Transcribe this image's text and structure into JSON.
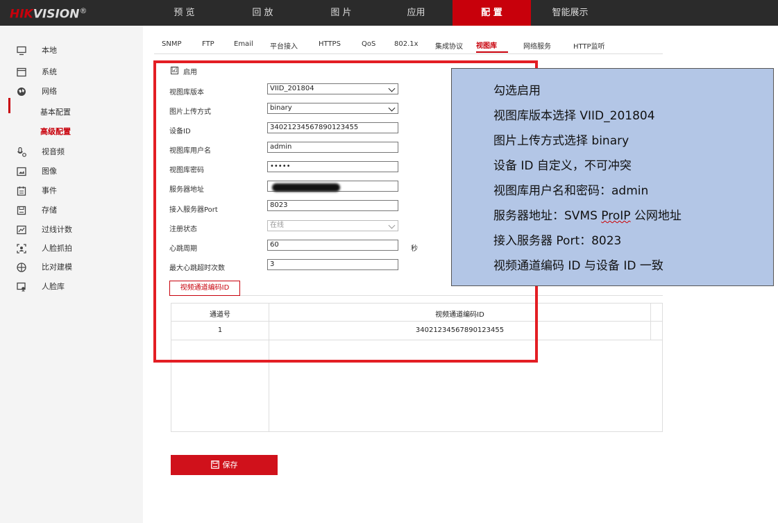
{
  "brand": {
    "name_red": "HIK",
    "name_white": "VISION",
    "mark": "®"
  },
  "top_nav": [
    {
      "label": "预 览",
      "active": false
    },
    {
      "label": "回 放",
      "active": false
    },
    {
      "label": "图 片",
      "active": false
    },
    {
      "label": "应用",
      "active": false
    },
    {
      "label": "配 置",
      "active": true
    },
    {
      "label": "智能展示",
      "active": false
    }
  ],
  "sidebar": {
    "items": [
      {
        "label": "本地",
        "icon": "monitor-icon"
      },
      {
        "label": "系统",
        "icon": "system-icon"
      },
      {
        "label": "网络",
        "icon": "globe-icon"
      },
      {
        "label": "视音频",
        "icon": "audio-video-icon"
      },
      {
        "label": "图像",
        "icon": "image-icon"
      },
      {
        "label": "事件",
        "icon": "calendar-icon"
      },
      {
        "label": "存储",
        "icon": "save-icon"
      },
      {
        "label": "过线计数",
        "icon": "line-count-icon"
      },
      {
        "label": "人脸抓拍",
        "icon": "face-capture-icon"
      },
      {
        "label": "比对建模",
        "icon": "compare-model-icon"
      },
      {
        "label": "人脸库",
        "icon": "face-library-icon"
      }
    ],
    "network_sub": [
      {
        "label": "基本配置",
        "active": false
      },
      {
        "label": "高级配置",
        "active": true
      }
    ]
  },
  "sub_tabs": [
    {
      "label": "SNMP",
      "active": false
    },
    {
      "label": "FTP",
      "active": false
    },
    {
      "label": "Email",
      "active": false
    },
    {
      "label": "平台接入",
      "active": false
    },
    {
      "label": "HTTPS",
      "active": false
    },
    {
      "label": "QoS",
      "active": false
    },
    {
      "label": "802.1x",
      "active": false
    },
    {
      "label": "集成协议",
      "active": false
    },
    {
      "label": "视图库",
      "active": true
    },
    {
      "label": "网络服务",
      "active": false
    },
    {
      "label": "HTTP监听",
      "active": false
    }
  ],
  "form": {
    "enable_label": "启用",
    "enable_checked": "☑",
    "fields": [
      {
        "label": "视图库版本",
        "value": "VIID_201804"
      },
      {
        "label": "图片上传方式",
        "value": "binary"
      },
      {
        "label": "设备ID",
        "value": "34021234567890123455"
      },
      {
        "label": "视图库用户名",
        "value": "admin"
      },
      {
        "label": "视图库密码",
        "value": "•••••"
      },
      {
        "label": "服务器地址",
        "value": ""
      },
      {
        "label": "接入服务器Port",
        "value": "8023"
      },
      {
        "label": "注册状态",
        "value": "在线"
      },
      {
        "label": "心跳周期",
        "value": "60",
        "unit": "秒"
      },
      {
        "label": "最大心跳超时次数",
        "value": "3"
      }
    ]
  },
  "channel_tab": "视频通道编码ID",
  "table": {
    "headers": [
      "通道号",
      "视频通道编码ID"
    ],
    "rows": [
      [
        "1",
        "34021234567890123455"
      ]
    ]
  },
  "callout": {
    "lines": [
      "勾选启用",
      "视图库版本选择 VIID_201804",
      "图片上传方式选择 binary",
      "设备 ID 自定义，不可冲突",
      "视图库用户名和密码：admin",
      "服务器地址：SVMS ",
      "ProIP",
      " 公网地址",
      "接入服务器 Port：8023",
      "视频通道编码 ID 与设备 ID 一致"
    ]
  },
  "save_button": {
    "label": "保存"
  },
  "colors": {
    "accent": "#c8000b",
    "topbar": "#2b2b2b",
    "callout_bg": "#b3c6e6",
    "highlight_border": "#e31e24"
  }
}
